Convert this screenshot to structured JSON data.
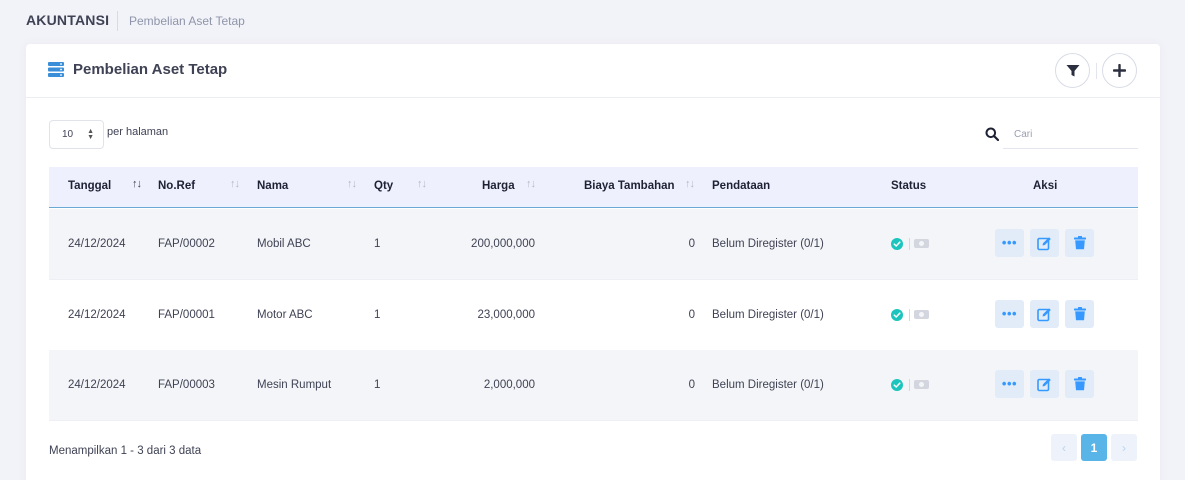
{
  "breadcrumb": {
    "module": "AKUNTANSI",
    "page": "Pembelian Aset Tetap"
  },
  "card": {
    "title": "Pembelian Aset Tetap"
  },
  "controls": {
    "per_page_value": "10",
    "per_page_label": "per halaman",
    "search_placeholder": "Cari"
  },
  "table": {
    "headers": {
      "tanggal": "Tanggal",
      "noref": "No.Ref",
      "nama": "Nama",
      "qty": "Qty",
      "harga": "Harga",
      "biaya": "Biaya Tambahan",
      "pendataan": "Pendataan",
      "status": "Status",
      "aksi": "Aksi"
    },
    "rows": [
      {
        "tanggal": "24/12/2024",
        "noref": "FAP/00002",
        "nama": "Mobil ABC",
        "qty": "1",
        "harga": "200,000,000",
        "biaya": "0",
        "pendataan": "Belum Diregister (0/1)"
      },
      {
        "tanggal": "24/12/2024",
        "noref": "FAP/00001",
        "nama": "Motor ABC",
        "qty": "1",
        "harga": "23,000,000",
        "biaya": "0",
        "pendataan": "Belum Diregister (0/1)"
      },
      {
        "tanggal": "24/12/2024",
        "noref": "FAP/00003",
        "nama": "Mesin Rumput",
        "qty": "1",
        "harga": "2,000,000",
        "biaya": "0",
        "pendataan": "Belum Diregister (0/1)"
      }
    ]
  },
  "footer": {
    "info": "Menampilkan 1 - 3 dari 3 data"
  },
  "pagination": {
    "prev": "‹",
    "current": "1",
    "next": "›"
  },
  "icons": {
    "title": "server-list-icon",
    "filter": "filter-icon",
    "add": "plus-icon",
    "search": "search-icon",
    "status_ok": "check-circle-icon",
    "status_cam": "camera-icon",
    "more": "more-dots-icon",
    "edit": "edit-icon",
    "delete": "trash-icon"
  },
  "colors": {
    "accent": "#59b4e8",
    "status_ok": "#1bc5bd",
    "action": "#3699ff",
    "header_bg": "#eef1fd"
  }
}
